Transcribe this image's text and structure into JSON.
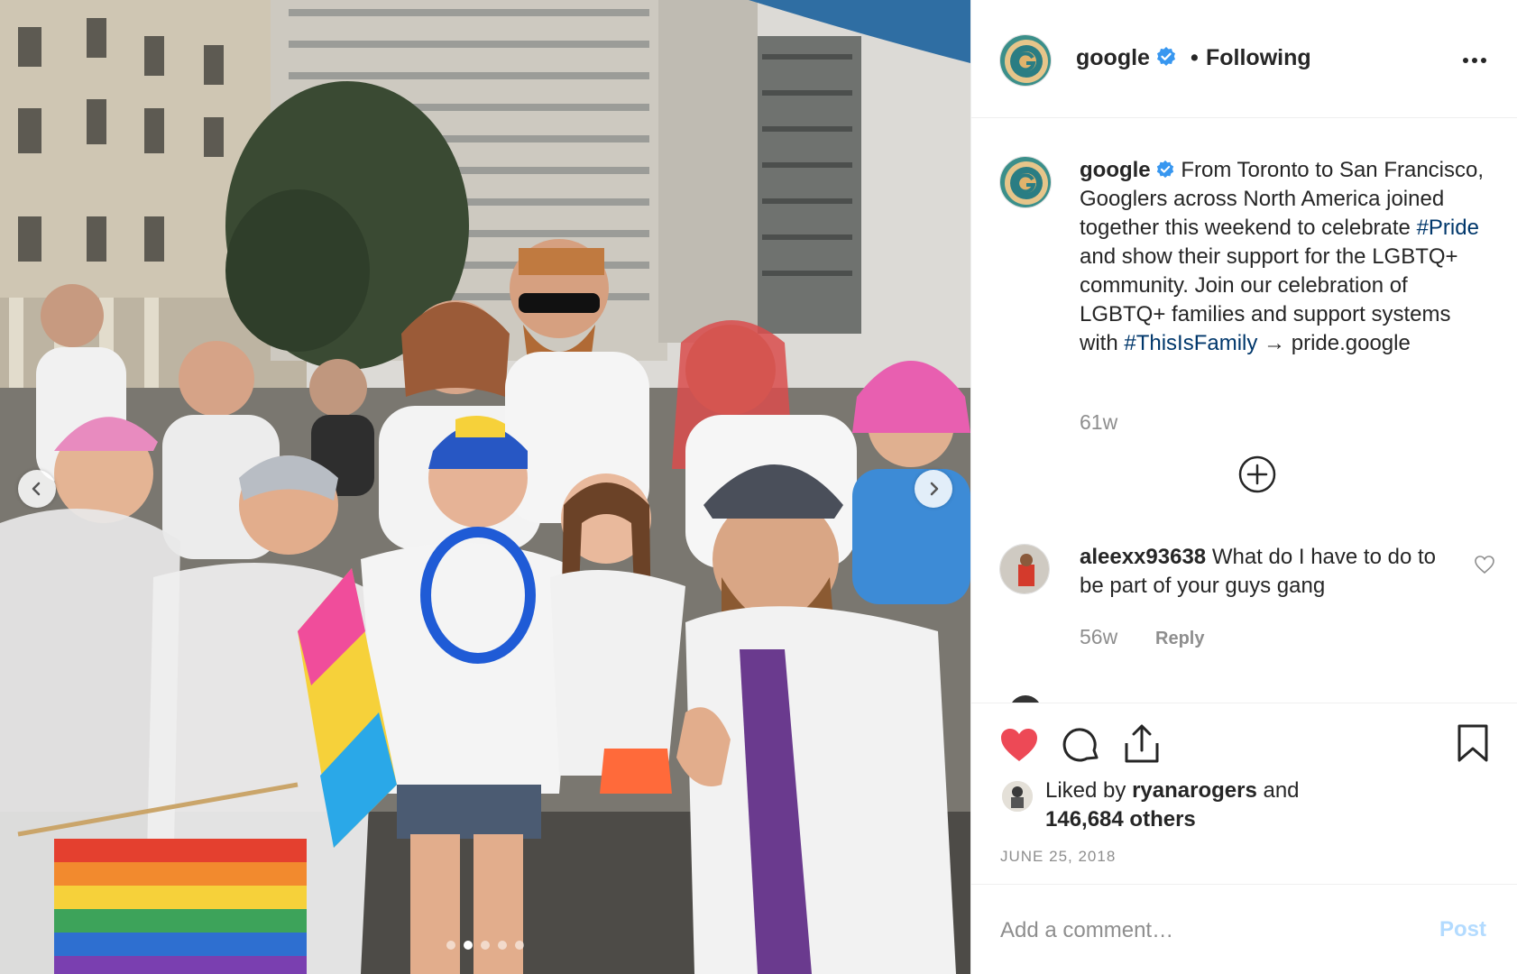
{
  "post": {
    "username": "google",
    "separator": "•",
    "follow_status": "Following",
    "caption_user": "google",
    "caption_parts": {
      "t1": " From Toronto to San Francisco, Googlers across North America joined together this weekend to celebrate ",
      "tag1": "#Pride",
      "t2": " and show their support for the LGBTQ+ community. Join our celebration of LGBTQ+ families and support systems with ",
      "tag2": "#ThisIsFamily",
      "t3": " → pride.google"
    },
    "caption_time": "61w",
    "likes_user": "ryanarogers",
    "likes_mid": " and",
    "likes_count": "146,684 others",
    "likes_prefix": "Liked by ",
    "date": "JUNE 25, 2018"
  },
  "comments": [
    {
      "user": "aleexx93638",
      "text": " What do I have to do to be part of your guys gang",
      "time": "56w",
      "reply": "Reply"
    }
  ],
  "composer": {
    "placeholder": "Add a comment…",
    "post_label": "Post"
  },
  "carousel": {
    "slide_count": 5,
    "active_index": 1
  },
  "icons": [
    "more-icon",
    "verified-icon",
    "plus-circle-icon",
    "heart-outline-icon",
    "heart-filled-icon",
    "comment-icon",
    "share-icon",
    "bookmark-icon",
    "chevron-left-icon",
    "chevron-right-icon"
  ],
  "colors": {
    "heart": "#ed4956",
    "verified": "#3897f0",
    "hashtag": "#00376b",
    "post_disabled": "#b3dbff"
  }
}
